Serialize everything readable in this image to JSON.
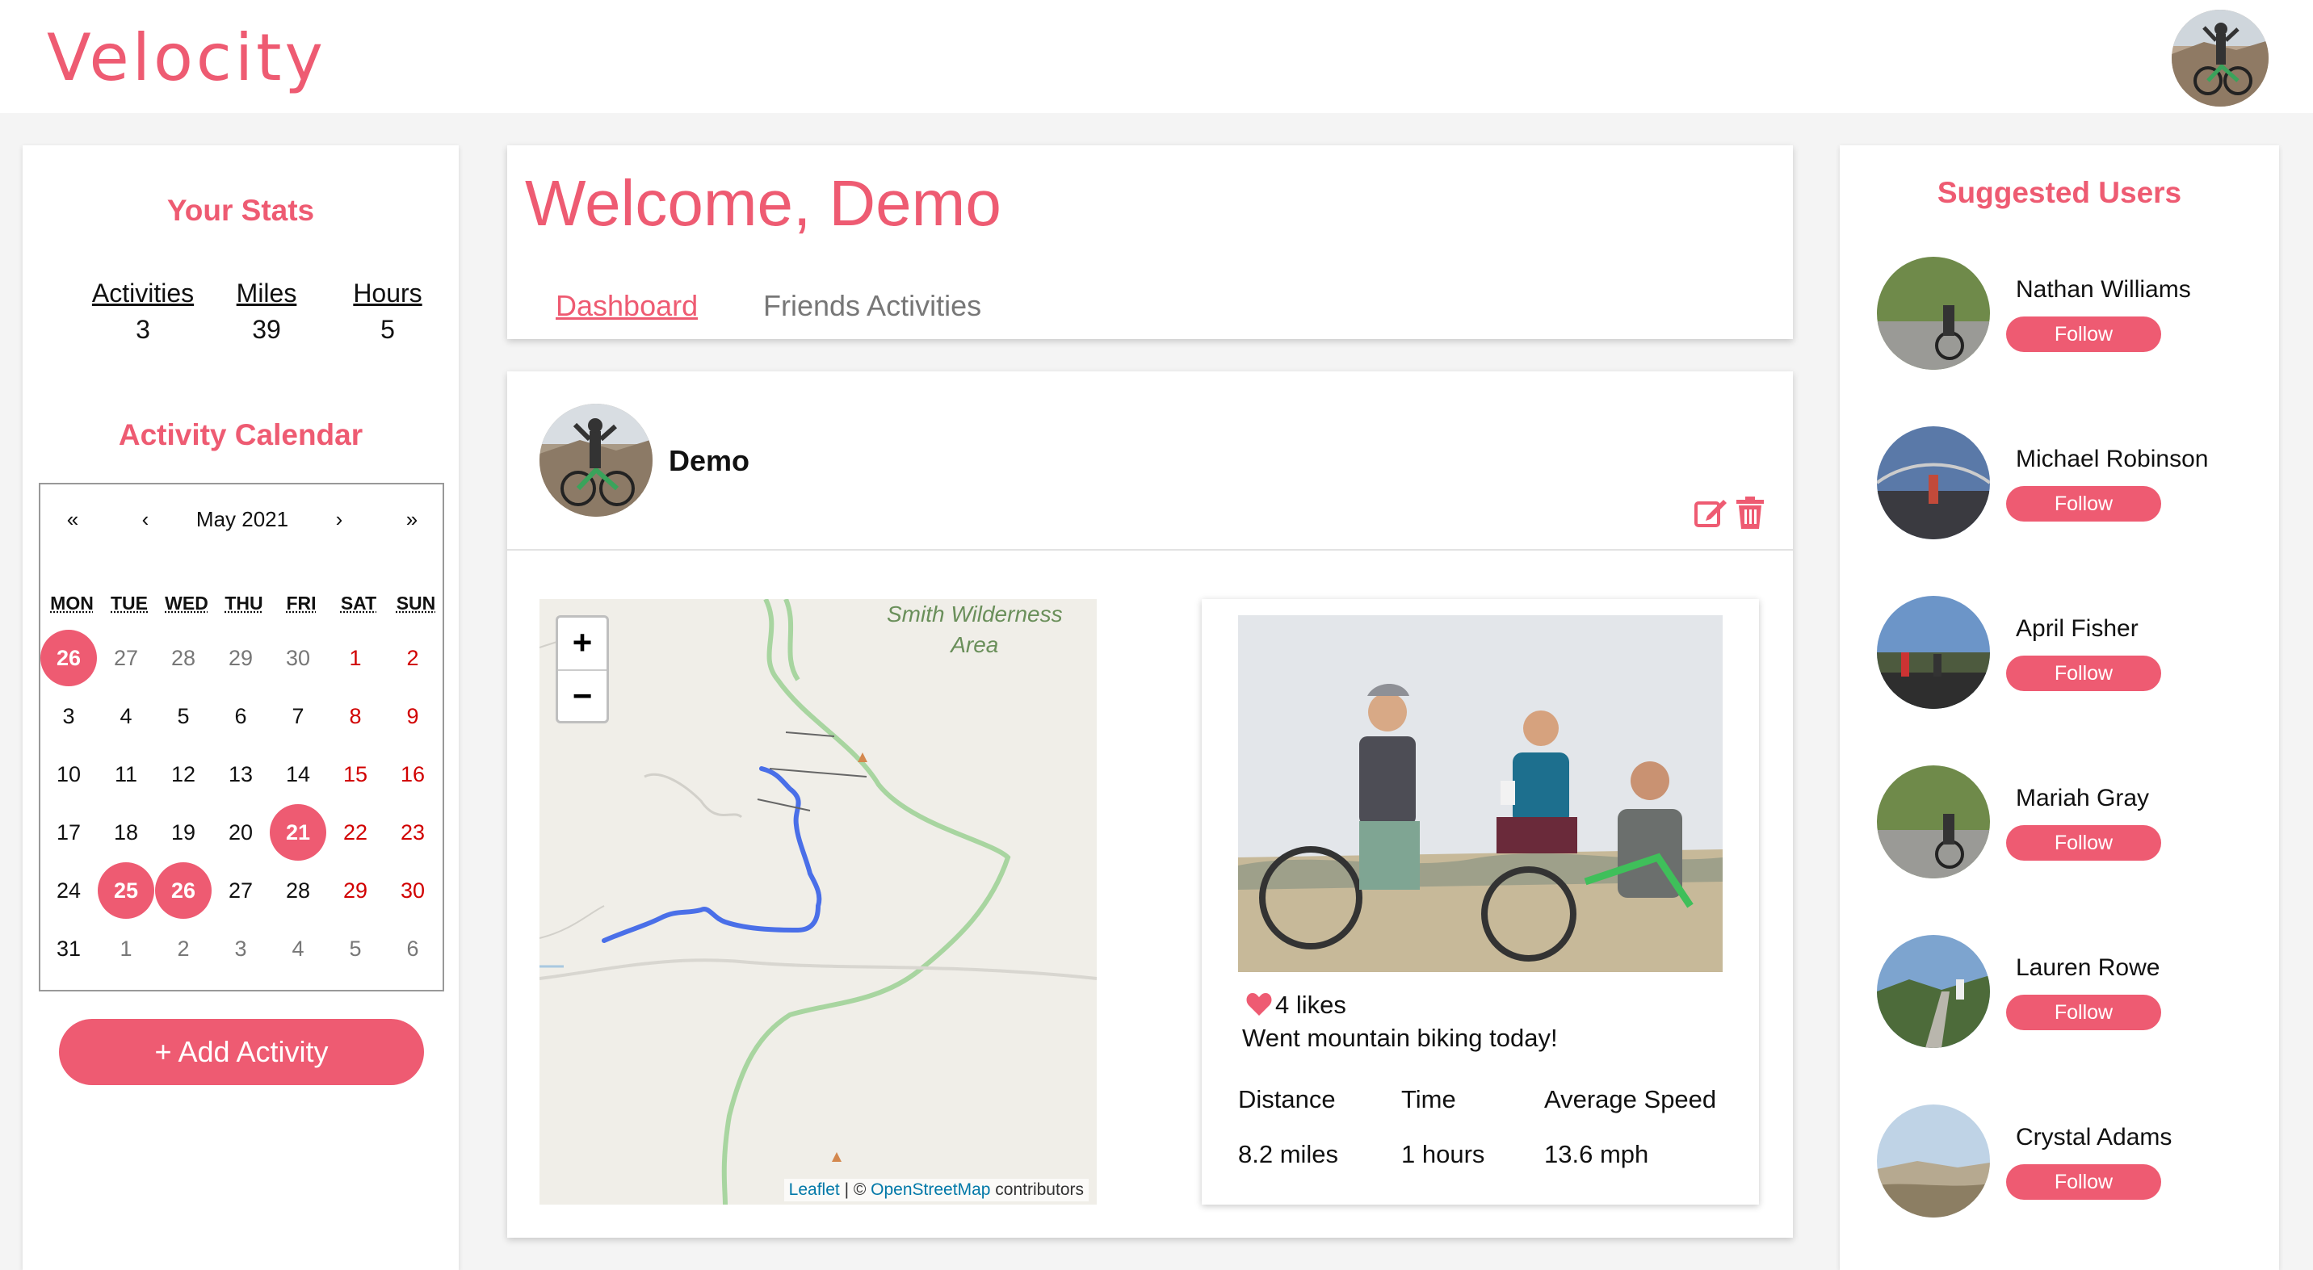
{
  "header": {
    "logo_text": "Velocity",
    "brand_color": "#ee5b72"
  },
  "stats": {
    "title": "Your Stats",
    "items": [
      {
        "label": "Activities",
        "value": "3"
      },
      {
        "label": "Miles",
        "value": "39"
      },
      {
        "label": "Hours",
        "value": "5"
      }
    ]
  },
  "calendar": {
    "title": "Activity Calendar",
    "nav": {
      "prev_year": "«",
      "prev_month": "‹",
      "month_label": "May 2021",
      "next_month": "›",
      "next_year": "»"
    },
    "weekdays": [
      "MON",
      "TUE",
      "WED",
      "THU",
      "FRI",
      "SAT",
      "SUN"
    ],
    "weeks": [
      [
        "26",
        "27",
        "28",
        "29",
        "30",
        "1",
        "2"
      ],
      [
        "3",
        "4",
        "5",
        "6",
        "7",
        "8",
        "9"
      ],
      [
        "10",
        "11",
        "12",
        "13",
        "14",
        "15",
        "16"
      ],
      [
        "17",
        "18",
        "19",
        "20",
        "21",
        "22",
        "23"
      ],
      [
        "24",
        "25",
        "26",
        "27",
        "28",
        "29",
        "30"
      ],
      [
        "31",
        "1",
        "2",
        "3",
        "4",
        "5",
        "6"
      ]
    ],
    "highlighted_days": [
      "26 (Apr)",
      "21",
      "25",
      "26"
    ]
  },
  "add_activity": {
    "label": "+ Add Activity"
  },
  "welcome": {
    "title": "Welcome, Demo",
    "tabs": [
      {
        "label": "Dashboard",
        "active": true
      },
      {
        "label": "Friends Activities",
        "active": false
      }
    ]
  },
  "post": {
    "username": "Demo",
    "edit_icon": "edit-icon",
    "delete_icon": "trash-icon",
    "map": {
      "area_label_line1": "Smith Wilderness",
      "area_label_line2": "Area",
      "zoom_in": "+",
      "zoom_out": "−",
      "attribution_leaflet": "Leaflet",
      "attribution_sep": " | © ",
      "attribution_osm": "OpenStreetMap",
      "attribution_tail": " contributors"
    },
    "likes": "4 likes",
    "caption": "Went mountain biking today!",
    "metrics": [
      {
        "label": "Distance",
        "value": "8.2 miles"
      },
      {
        "label": "Time",
        "value": "1 hours"
      },
      {
        "label": "Average Speed",
        "value": "13.6 mph"
      }
    ]
  },
  "suggested": {
    "title": "Suggested Users",
    "follow_label": "Follow",
    "users": [
      {
        "name": "Nathan Williams"
      },
      {
        "name": "Michael Robinson"
      },
      {
        "name": "April Fisher"
      },
      {
        "name": "Mariah Gray"
      },
      {
        "name": "Lauren Rowe"
      },
      {
        "name": "Crystal Adams"
      }
    ]
  }
}
